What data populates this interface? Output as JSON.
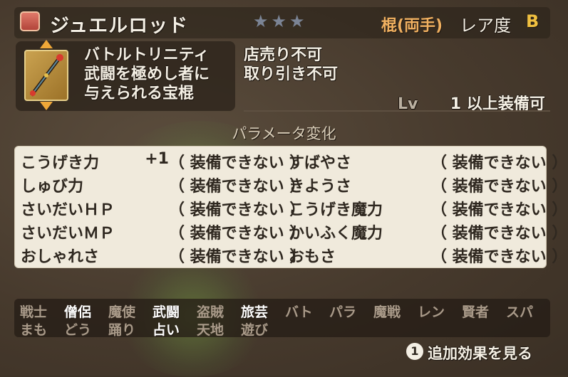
{
  "header": {
    "item_name": "ジュエルロッド",
    "stars": "★★★",
    "category": "棍(両手)",
    "rarity_label": "レア度",
    "rarity_value": "B"
  },
  "description": {
    "lines": [
      "バトルトリニティ",
      "武闘を極めし者に",
      "与えられる宝棍"
    ]
  },
  "restrictions": [
    "店売り不可",
    "取り引き不可"
  ],
  "level": {
    "label": "Lv",
    "value": "1",
    "suffix": "以上装備可"
  },
  "param_title": "パラメータ変化",
  "params_left": [
    {
      "name": "こうげき力",
      "delta": "+1",
      "status": "（ 装備できない ）"
    },
    {
      "name": "しゅび力",
      "delta": "",
      "status": "（ 装備できない ）"
    },
    {
      "name": "さいだいＨＰ",
      "delta": "",
      "status": "（ 装備できない ）"
    },
    {
      "name": "さいだいＭＰ",
      "delta": "",
      "status": "（ 装備できない ）"
    },
    {
      "name": "おしゃれさ",
      "delta": "",
      "status": "（ 装備できない ）"
    }
  ],
  "params_right": [
    {
      "name": "すばやさ",
      "status": "（ 装備できない ）"
    },
    {
      "name": "きようさ",
      "status": "（ 装備できない ）"
    },
    {
      "name": "こうげき魔力",
      "status": "（ 装備できない ）"
    },
    {
      "name": "かいふく魔力",
      "status": "（ 装備できない ）"
    },
    {
      "name": "おもさ",
      "status": "（ 装備できない ）"
    }
  ],
  "jobs": {
    "row1": [
      {
        "name": "戦士",
        "equippable": false
      },
      {
        "name": "僧侶",
        "equippable": true
      },
      {
        "name": "魔使",
        "equippable": false
      },
      {
        "name": "武闘",
        "equippable": true
      },
      {
        "name": "盗賊",
        "equippable": false
      },
      {
        "name": "旅芸",
        "equippable": true
      },
      {
        "name": "バト",
        "equippable": false
      },
      {
        "name": "パラ",
        "equippable": false
      },
      {
        "name": "魔戦",
        "equippable": false
      },
      {
        "name": "レン",
        "equippable": false
      },
      {
        "name": "賢者",
        "equippable": false
      },
      {
        "name": "スパ",
        "equippable": false
      }
    ],
    "row2": [
      {
        "name": "まも",
        "equippable": false
      },
      {
        "name": "どう",
        "equippable": false
      },
      {
        "name": "踊り",
        "equippable": false
      },
      {
        "name": "占い",
        "equippable": true
      },
      {
        "name": "天地",
        "equippable": false
      },
      {
        "name": "遊び",
        "equippable": false
      }
    ]
  },
  "hint": {
    "button": "1",
    "text": "追加効果を見る"
  }
}
